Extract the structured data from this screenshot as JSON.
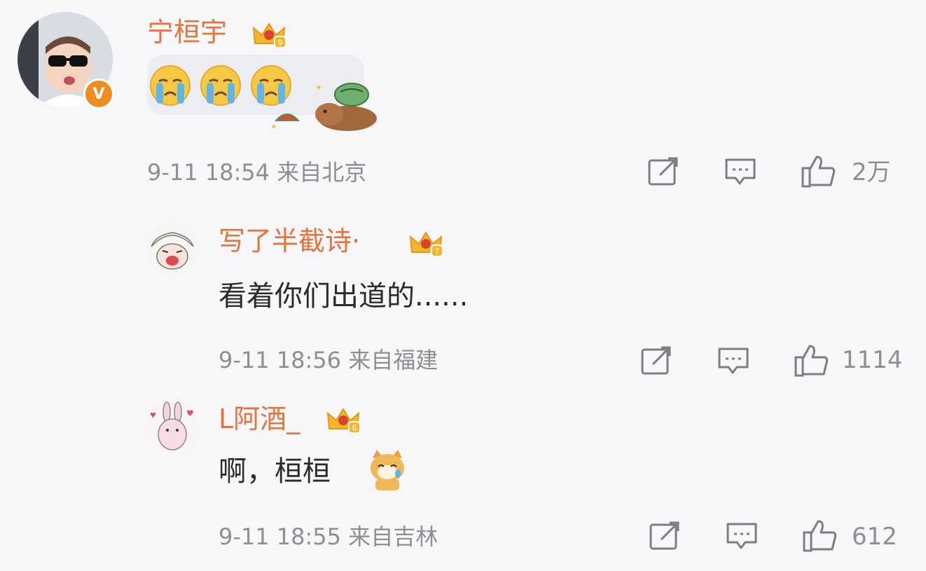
{
  "colors": {
    "background": "#f7f7f9",
    "username": "#e8733a",
    "content_text": "#2b2b2b",
    "meta_text": "#8e8e93",
    "verified_badge": "#f08b1f",
    "crown": "#f5b52a"
  },
  "comment": {
    "username": "宁桓宇",
    "crown_level": "9",
    "verified_mark": "V",
    "meta": "9-11 18:54  来自北京",
    "like_count": "2万",
    "emoji": [
      "crying-face",
      "crying-face",
      "crying-face",
      "capybara-sticker"
    ]
  },
  "replies": [
    {
      "username": "写了半截诗·",
      "crown_level": "7",
      "text": "看着你们出道的......",
      "meta": "9-11 18:56  来自福建",
      "like_count": "1114"
    },
    {
      "username": "L阿酒_",
      "crown_level": "6",
      "text": "啊，桓桓",
      "meta": "9-11 18:55  来自吉林",
      "like_count": "612",
      "emoji": "crying-dog-sticker"
    }
  ],
  "icons": [
    "share-icon",
    "reply-icon",
    "like-icon"
  ]
}
